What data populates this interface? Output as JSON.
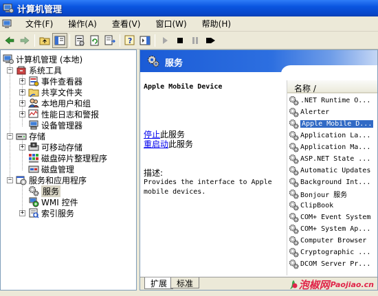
{
  "window": {
    "title": "计算机管理"
  },
  "menu": {
    "items": [
      {
        "label": "文件(F)"
      },
      {
        "label": "操作(A)"
      },
      {
        "label": "查看(V)"
      },
      {
        "label": "窗口(W)"
      },
      {
        "label": "帮助(H)"
      }
    ]
  },
  "tree": {
    "root": "计算机管理 (本地)",
    "system_tools": "系统工具",
    "event_viewer": "事件查看器",
    "shared_folders": "共享文件夹",
    "local_users": "本地用户和组",
    "perf_logs": "性能日志和警报",
    "device_manager": "设备管理器",
    "storage": "存储",
    "removable_storage": "可移动存储",
    "defrag": "磁盘碎片整理程序",
    "disk_management": "磁盘管理",
    "services_apps": "服务和应用程序",
    "services": "服务",
    "wmi": "WMI 控件",
    "indexing": "索引服务"
  },
  "right_pane": {
    "header_title": "服务",
    "service_name": "Apple Mobile Device",
    "stop_link": "停止",
    "stop_suffix": "此服务",
    "restart_link": "重启动",
    "restart_suffix": "此服务",
    "description_label": "描述:",
    "description_text": "Provides the interface to Apple mobile devices.",
    "column_header": "名称 /",
    "services_list": [
      ".NET Runtime O...",
      "Alerter",
      "Apple Mobile D...",
      "Application La...",
      "Application Ma...",
      "ASP.NET State ...",
      "Automatic Updates",
      "Background Int...",
      "Bonjour 服务",
      "ClipBook",
      "COM+ Event System",
      "COM+ System Ap...",
      "Computer Browser",
      "Cryptographic ...",
      "DCOM Server Pr..."
    ],
    "selected_index": 2,
    "tabs": {
      "extended": "扩展",
      "standard": "标准"
    }
  },
  "watermark": {
    "brand": "泡椒网",
    "url": "Paojiao.cn"
  },
  "colors": {
    "title_bar": "#0a55e0",
    "selection": "#316ac5",
    "link": "#0000ee",
    "header_blue": "#1a5bd6"
  }
}
